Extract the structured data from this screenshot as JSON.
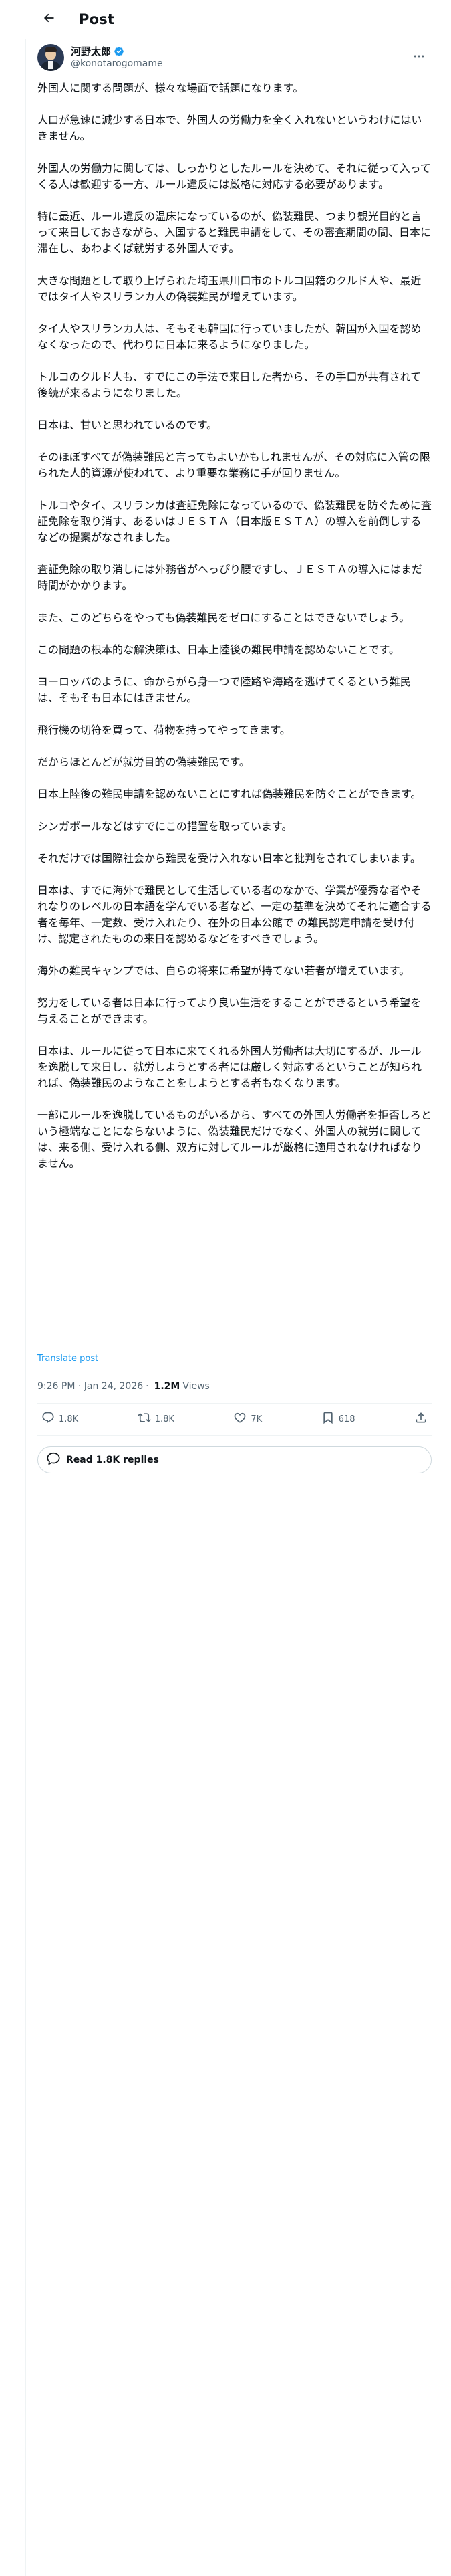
{
  "header": {
    "title": "Post",
    "back_icon": "arrow-left-icon"
  },
  "author": {
    "name": "河野太郎",
    "handle": "@konotarogomame",
    "verified_icon": "verified-badge-icon",
    "verified_color": "#1d9bf0",
    "more_icon": "more-horizontal-icon"
  },
  "post": {
    "paragraphs": [
      "外国人に関する問題が、様々な場面で話題になります。",
      "人口が急速に減少する日本で、外国人の労働力を全く入れないというわけにはいきません。",
      "外国人の労働力に関しては、しっかりとしたルールを決めて、それに従って入ってくる人は歓迎する一方、ルール違反には厳格に対応する必要があります。",
      "特に最近、ルール違反の温床になっているのが、偽装難民、つまり観光目的と言って来日しておきながら、入国すると難民申請をして、その審査期間の間、日本に滞在し、あわよくば就労する外国人です。",
      "大きな問題として取り上げられた埼玉県川口市のトルコ国籍のクルド人や、最近ではタイ人やスリランカ人の偽装難民が増えています。",
      "タイ人やスリランカ人は、そもそも韓国に行っていましたが、韓国が入国を認めなくなったので、代わりに日本に来るようになりました。",
      "トルコのクルド人も、すでにこの手法で来日した者から、その手口が共有されて後続が来るようになりました。",
      "日本は、甘いと思われているのです。",
      "そのほぼすべてが偽装難民と言ってもよいかもしれませんが、その対応に入管の限られた人的資源が使われて、より重要な業務に手が回りません。",
      "トルコやタイ、スリランカは査証免除になっているので、偽装難民を防ぐために査証免除を取り消す、あるいはＪＥＳＴＡ（日本版ＥＳＴＡ）の導入を前倒しするなどの提案がなされました。",
      "査証免除の取り消しには外務省がへっぴり腰ですし、ＪＥＳＴＡの導入にはまだ時間がかかります。",
      "また、このどちらをやっても偽装難民をゼロにすることはできないでしょう。",
      "この問題の根本的な解決策は、日本上陸後の難民申請を認めないことです。",
      "ヨーロッパのように、命からがら身一つで陸路や海路を逃げてくるという難民は、そもそも日本にはきません。",
      "飛行機の切符を買って、荷物を持ってやってきます。",
      "だからほとんどが就労目的の偽装難民です。",
      "日本上陸後の難民申請を認めないことにすれば偽装難民を防ぐことができます。",
      "シンガポールなどはすでにこの措置を取っています。",
      "それだけでは国際社会から難民を受け入れない日本と批判をされてしまいます。",
      "日本は、すでに海外で難民として生活している者のなかで、学業が優秀な者やそれなりのレベルの日本語を学んでいる者など、一定の基準を決めてそれに適合する者を毎年、一定数、受け入れたり、在外の日本公館で の難民認定申請を受け付け、認定されたものの来日を認めるなどをすべきでしょう。",
      "海外の難民キャンプでは、自らの将来に希望が持てない若者が増えています。",
      "努力をしている者は日本に行ってより良い生活をすることができるという希望を与えることができます。",
      "日本は、ルールに従って日本に来てくれる外国人労働者は大切にするが、ルールを逸脱して来日し、就労しようとする者には厳しく対応するということが知られれば、偽装難民のようなことをしようとする者もなくなります。",
      "一部にルールを逸脱しているものがいるから、すべての外国人労働者を拒否しろという極端なことにならないように、偽装難民だけでなく、外国人の就労に関しては、来る側、受け入れる側、双方に対してルールが厳格に適用されなければなりません。"
    ],
    "translate_label": "Translate post",
    "link_color": "#1d9bf0",
    "timestamp": "9:26 PM · Jan 24, 2026",
    "views_count": "1.2M",
    "views_label": "Views"
  },
  "actions": {
    "reply": {
      "icon": "reply-icon",
      "count": "1.8K"
    },
    "repost": {
      "icon": "repost-icon",
      "count": "1.8K"
    },
    "like": {
      "icon": "heart-icon",
      "count": "7K"
    },
    "bookmark": {
      "icon": "bookmark-icon",
      "count": "618"
    },
    "share": {
      "icon": "share-icon"
    }
  },
  "replies_button": {
    "icon": "chat-bubble-icon",
    "label": "Read 1.8K replies"
  }
}
